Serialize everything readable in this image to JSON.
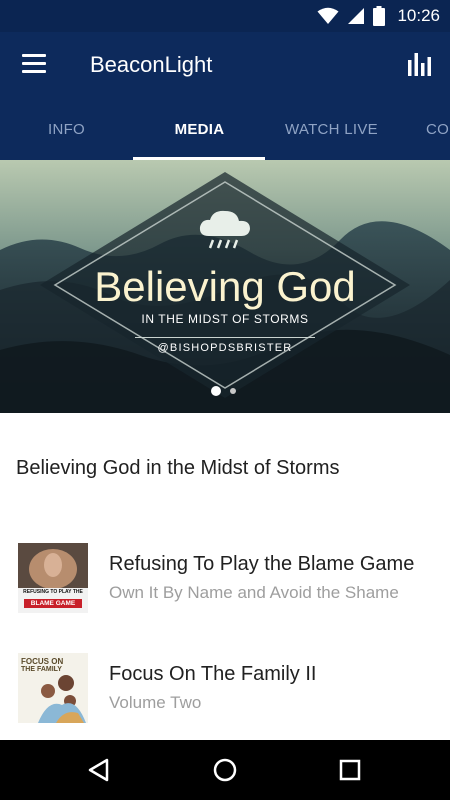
{
  "status_bar": {
    "time": "10:26",
    "icons": [
      "wifi-icon",
      "signal-icon",
      "battery-icon"
    ]
  },
  "app_bar": {
    "title": "BeaconLight",
    "menu_icon": "hamburger-menu-icon",
    "action_icon": "bar-chart-icon"
  },
  "tabs": [
    {
      "label": "INFO",
      "active": false
    },
    {
      "label": "MEDIA",
      "active": true
    },
    {
      "label": "WATCH LIVE",
      "active": false
    },
    {
      "label": "CONNECT",
      "active": false
    }
  ],
  "banner": {
    "title": "Believing God",
    "subtitle": "IN THE MIDST OF STORMS",
    "handle": "@BISHOPDSBRISTER",
    "icon": "rain-cloud-icon",
    "page_count": 2,
    "active_page": 1
  },
  "featured": {
    "title": "Believing God in the Midst of Storms"
  },
  "media_items": [
    {
      "title": "Refusing To Play the Blame Game",
      "subtitle": "Own It By Name and Avoid the Shame",
      "thumb_text_top": "REFUSING TO PLAY THE",
      "thumb_text_main": "BLAME GAME"
    },
    {
      "title": "Focus On The Family II",
      "subtitle": "Volume Two",
      "thumb_text_top": "FOCUS ON",
      "thumb_text_main": "THE FAMILY"
    }
  ],
  "nav_bar": {
    "icons": [
      "back-icon",
      "home-icon",
      "recents-icon"
    ]
  },
  "colors": {
    "primary": "#0d2a5c",
    "status_bar": "#0b2552",
    "tab_inactive": "#8fa3c4",
    "text_primary": "#212121",
    "text_secondary": "#9e9e9e"
  }
}
